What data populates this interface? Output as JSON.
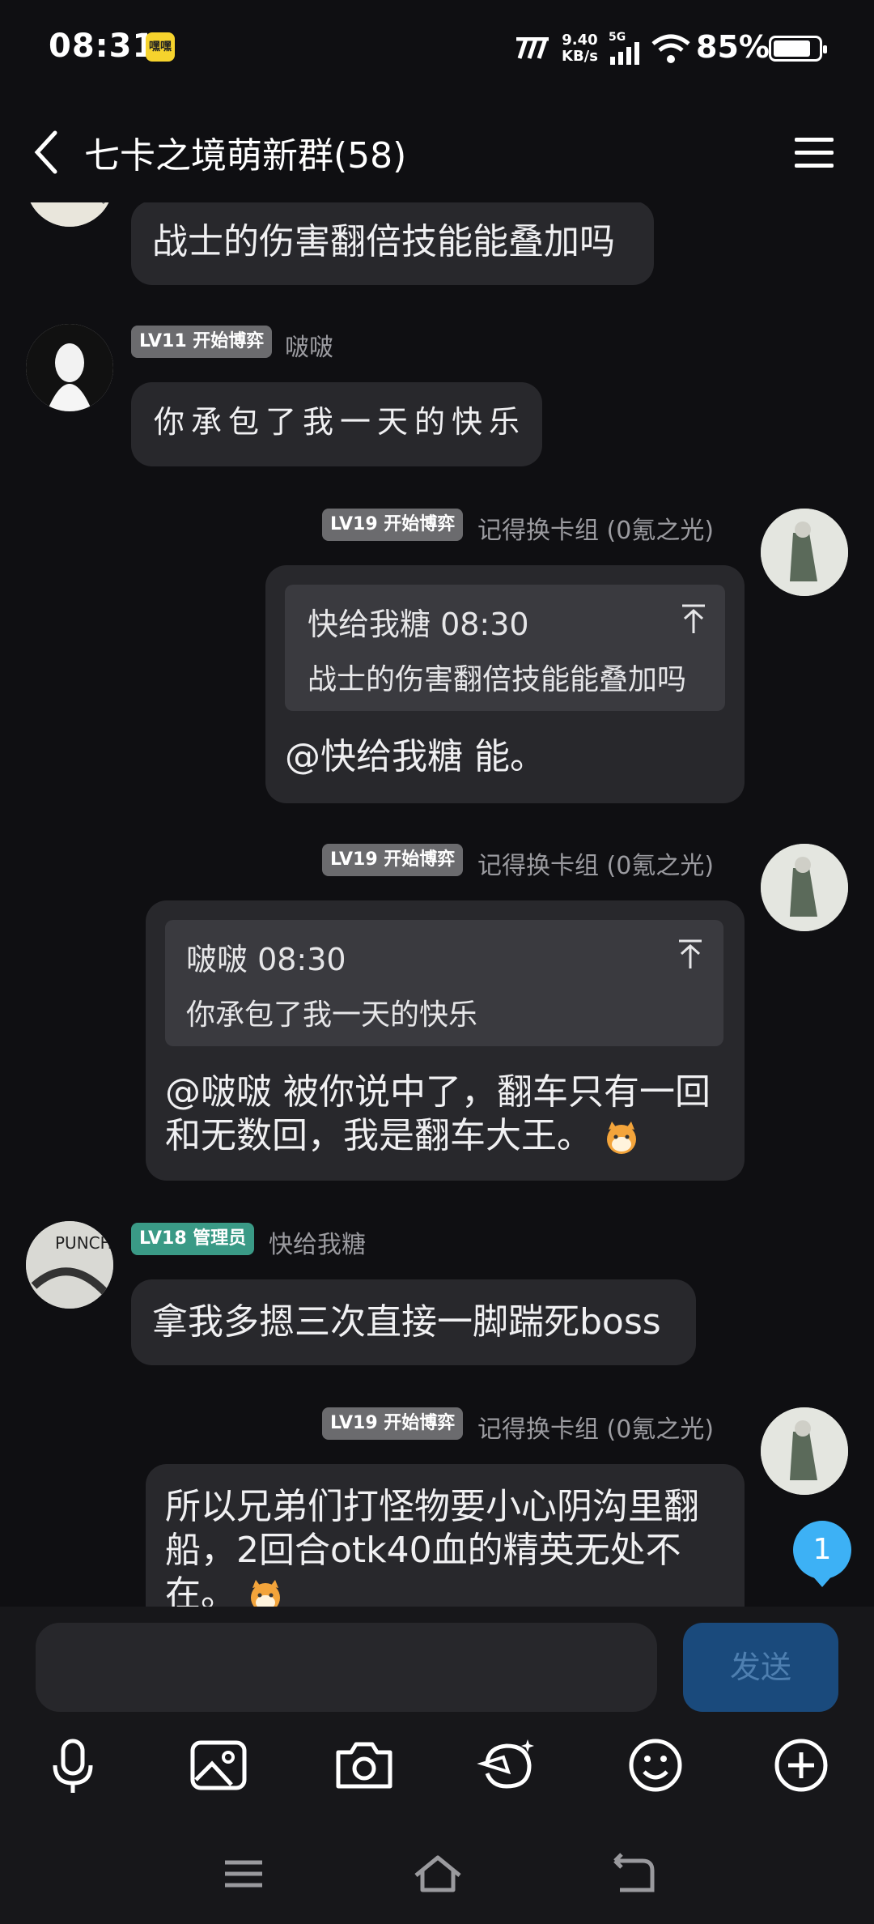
{
  "status_bar": {
    "time": "08:31",
    "badge": "嘿嘿",
    "net_speed": "9.40",
    "net_unit": "KB/s",
    "signal": "5G",
    "battery": "85%"
  },
  "header": {
    "title": "七卡之境萌新群(58)"
  },
  "messages": [
    {
      "text": "战士的伤害翻倍技能能叠加吗"
    },
    {
      "level": "LV11 开始博弈",
      "nick": "啵啵",
      "text": "你承包了我一天的快乐"
    },
    {
      "level": "LV19 开始博弈",
      "nick": "记得换卡组 (0氪之光)",
      "quote_author": "快给我糖 08:30",
      "quote_text": "战士的伤害翻倍技能能叠加吗",
      "text": "@快给我糖 能。"
    },
    {
      "level": "LV19 开始博弈",
      "nick": "记得换卡组 (0氪之光)",
      "quote_author": "啵啵 08:30",
      "quote_text": "你承包了我一天的快乐",
      "text_line1": "@啵啵 被你说中了，翻车只有一回",
      "text_line2": "和无数回，我是翻车大王。"
    },
    {
      "level": "LV18 管理员",
      "nick": "快给我糖",
      "text": "拿我多摁三次直接一脚踹死boss"
    },
    {
      "level": "LV19 开始博弈",
      "nick": "记得换卡组 (0氪之光)",
      "text_line1": "所以兄弟们打怪物要小心阴沟里翻",
      "text_line2": "船，2回合otk40血的精英无处不",
      "text_line3": "在。"
    }
  ],
  "unread_count": "1",
  "input": {
    "send_label": "发送"
  },
  "toolbar": [
    "mic-icon",
    "image-icon",
    "camera-icon",
    "sticker-icon",
    "emoji-icon",
    "plus-icon"
  ],
  "colors": {
    "background": "#0f0f12",
    "bubble": "#28282c",
    "admin": "#3a9a86",
    "send": "#1a4a7c",
    "unread": "#3db1f5"
  }
}
